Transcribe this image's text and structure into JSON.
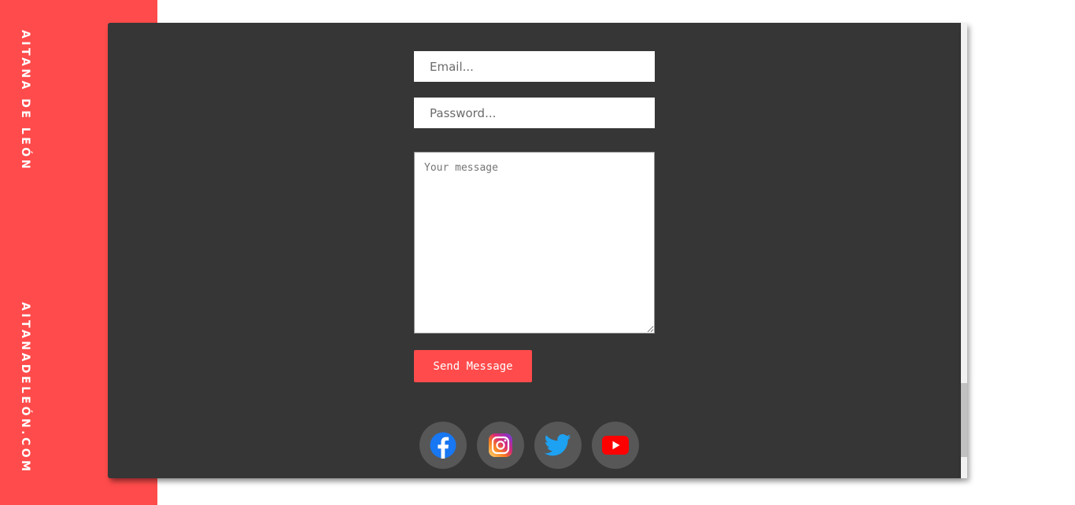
{
  "sidebar": {
    "name": "AITANA DE LEÓN",
    "site": "AITANADELEÓN.COM"
  },
  "form": {
    "email_placeholder": "Email...",
    "password_placeholder": "Password...",
    "message_placeholder": "Your message",
    "send_label": "Send Message"
  },
  "social": [
    {
      "icon": "facebook-icon",
      "color": "#1877f2"
    },
    {
      "icon": "instagram-icon",
      "color": "#e1306c"
    },
    {
      "icon": "twitter-icon",
      "color": "#1da1f2"
    },
    {
      "icon": "youtube-icon",
      "color": "#ff0000"
    }
  ],
  "colors": {
    "accent": "#ff4b4b",
    "panel": "#363636",
    "icon_circle": "#575757"
  }
}
